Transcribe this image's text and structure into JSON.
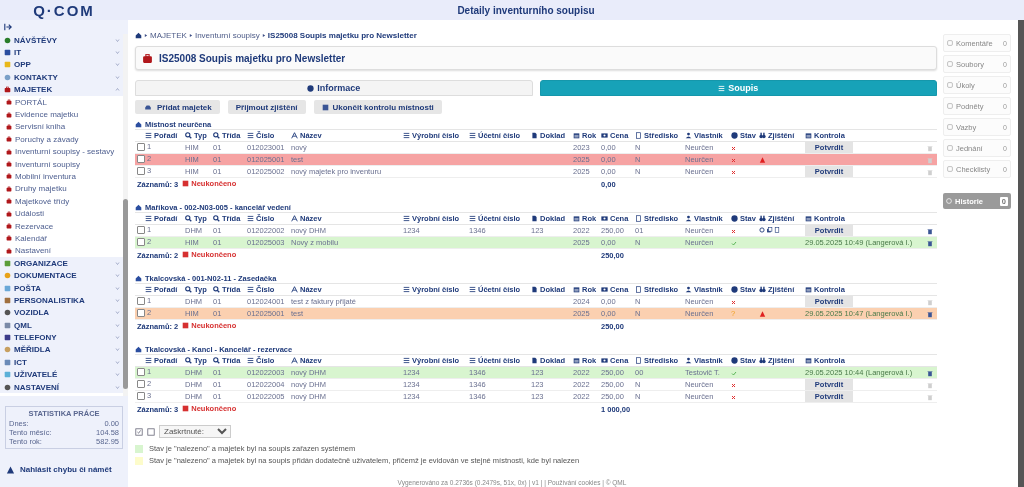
{
  "header": {
    "logo": "Q·COM",
    "title": "Detaily inventurního soupisu"
  },
  "sidebar": {
    "items": [
      {
        "label": "NÁVŠTĚVY",
        "expanded": false
      },
      {
        "label": "IT",
        "expanded": false
      },
      {
        "label": "OPP",
        "expanded": false
      },
      {
        "label": "KONTAKTY",
        "expanded": false
      },
      {
        "label": "MAJETEK",
        "expanded": true,
        "children": [
          {
            "label": "PORTÁL"
          },
          {
            "label": "Evidence majetku"
          },
          {
            "label": "Servisní kniha"
          },
          {
            "label": "Poruchy a závady"
          },
          {
            "label": "Inventurní soupisy - sestavy"
          },
          {
            "label": "Inventurní soupisy"
          },
          {
            "label": "Mobilní inventura"
          },
          {
            "label": "Druhy majetku"
          },
          {
            "label": "Majetkové třídy"
          },
          {
            "label": "Události"
          },
          {
            "label": "Rezervace"
          },
          {
            "label": "Kalendář"
          },
          {
            "label": "Nastavení"
          }
        ]
      },
      {
        "label": "ORGANIZACE",
        "expanded": false
      },
      {
        "label": "DOKUMENTACE",
        "expanded": false
      },
      {
        "label": "POŠTA",
        "expanded": false
      },
      {
        "label": "PERSONALISTIKA",
        "expanded": false
      },
      {
        "label": "VOZIDLA",
        "expanded": false
      },
      {
        "label": "QML",
        "expanded": false
      },
      {
        "label": "TELEFONY",
        "expanded": false
      },
      {
        "label": "MĚŘIDLA",
        "expanded": false
      },
      {
        "label": "ICT",
        "expanded": false
      },
      {
        "label": "UŽIVATELÉ",
        "expanded": false
      },
      {
        "label": "NASTAVENÍ",
        "expanded": false
      }
    ],
    "stats": {
      "title": "STATISTIKA PRÁCE",
      "rows": [
        {
          "label": "Dnes:",
          "value": "0.00"
        },
        {
          "label": "Tento měsíc:",
          "value": "104.58"
        },
        {
          "label": "Tento rok:",
          "value": "582.95"
        }
      ]
    },
    "report_link": "Nahlásit chybu či námět"
  },
  "breadcrumb": [
    "MAJETEK",
    "Inventurní soupisy",
    "IS25008 Soupis majetku pro Newsletter"
  ],
  "page_title": "IS25008 Soupis majetku pro Newsletter",
  "tabs": [
    {
      "label": "Informace",
      "selected": false
    },
    {
      "label": "Soupis",
      "selected": true
    }
  ],
  "actions": [
    "Přidat majetek",
    "Přijmout zjištění",
    "Ukončit kontrolu místnosti"
  ],
  "sections": [
    {
      "title": "Místnost neurčena",
      "columns": [
        "Pořadí",
        "Typ",
        "Třída",
        "Číslo",
        "Název",
        "Výrobní číslo",
        "Účetní číslo",
        "Doklad",
        "Rok",
        "Cena",
        "Středisko",
        "Vlastník",
        "Stav",
        "Zjištění",
        "Kontrola"
      ],
      "rows": [
        {
          "checked": false,
          "poradi": "1",
          "typ": "HIM",
          "trida": "01",
          "cislo": "012023001",
          "nazev": "nový",
          "rok": "2023",
          "cena": "0,00",
          "stredisko": "N",
          "vlastnik": "Neurčen",
          "stav": {
            "kind": "missing"
          },
          "kontrola": {
            "kind": "button",
            "label": "Potvrdit"
          },
          "delete_enabled": false
        },
        {
          "checked": false,
          "color": "#f6a3a3",
          "poradi": "2",
          "typ": "HIM",
          "trida": "01",
          "cislo": "012025001",
          "nazev": "test",
          "rok": "2025",
          "cena": "0,00",
          "stredisko": "N",
          "vlastnik": "Neurčen",
          "stav": {
            "kind": "missing"
          },
          "zjisteni": {
            "kind": "warning"
          },
          "delete_enabled": false
        },
        {
          "checked": false,
          "poradi": "3",
          "typ": "HIM",
          "trida": "01",
          "cislo": "012025002",
          "nazev": "nový majetek pro inventuru",
          "rok": "2025",
          "cena": "0,00",
          "stredisko": "N",
          "vlastnik": "Neurčen",
          "stav": {
            "kind": "missing"
          },
          "kontrola": {
            "kind": "button",
            "label": "Potvrdit"
          },
          "delete_enabled": false
        }
      ],
      "count": "Záznamů: 3",
      "status": "Neukončeno",
      "total": "0,00"
    },
    {
      "title": "Maříkova - 002-N03-005 - kancelář vedení",
      "columns": [
        "Pořadí",
        "Typ",
        "Třída",
        "Číslo",
        "Název",
        "Výrobní číslo",
        "Účetní číslo",
        "Doklad",
        "Rok",
        "Cena",
        "Středisko",
        "Vlastník",
        "Stav",
        "Zjištění",
        "Kontrola"
      ],
      "rows": [
        {
          "checked": false,
          "poradi": "1",
          "typ": "DHM",
          "trida": "01",
          "cislo": "012022002",
          "nazev": "nový DHM",
          "vyrobni": "1234",
          "ucetni": "1346",
          "doklad": "123",
          "rok": "2022",
          "cena": "250,00",
          "stredisko": "01",
          "vlastnik": "Neurčen",
          "stav": {
            "kind": "missing"
          },
          "zjisteni": {
            "kind": "tools"
          },
          "kontrola": {
            "kind": "button",
            "label": "Potvrdit"
          },
          "delete_enabled": true
        },
        {
          "checked": false,
          "color": "#d8f5cf",
          "poradi": "2",
          "typ": "HIM",
          "trida": "01",
          "cislo": "012025003",
          "nazev": "Novy z mobilu",
          "rok": "2025",
          "cena": "0,00",
          "stredisko": "N",
          "vlastnik": "Neurčen",
          "stav": {
            "kind": "found"
          },
          "kontrola": {
            "kind": "text",
            "label": "29.05.2025 10:49 (Langerová I.)"
          },
          "delete_enabled": true
        }
      ],
      "count": "Záznamů: 2",
      "status": "Neukončeno",
      "total": "250,00"
    },
    {
      "title": "Tkalcovská - 001-N02-11 - Zasedačka",
      "columns": [
        "Pořadí",
        "Typ",
        "Třída",
        "Číslo",
        "Název",
        "Výrobní číslo",
        "Účetní číslo",
        "Doklad",
        "Rok",
        "Cena",
        "Středisko",
        "Vlastník",
        "Stav",
        "Zjištění",
        "Kontrola"
      ],
      "rows": [
        {
          "checked": false,
          "poradi": "1",
          "typ": "DHM",
          "trida": "01",
          "cislo": "012024001",
          "nazev": "test z faktury přijaté",
          "rok": "2024",
          "cena": "0,00",
          "stredisko": "N",
          "vlastnik": "Neurčen",
          "stav": {
            "kind": "missing"
          },
          "kontrola": {
            "kind": "button",
            "label": "Potvrdit"
          },
          "delete_enabled": false
        },
        {
          "checked": false,
          "color": "#fbd0b0",
          "poradi": "2",
          "typ": "HIM",
          "trida": "01",
          "cislo": "012025001",
          "nazev": "test",
          "rok": "2025",
          "cena": "0,00",
          "stredisko": "N",
          "vlastnik": "Neurčen",
          "stav": {
            "kind": "unknown",
            "symbol": "?"
          },
          "zjisteni": {
            "kind": "warning"
          },
          "kontrola": {
            "kind": "text",
            "label": "29.05.2025 10:47 (Langerová I.)"
          },
          "delete_enabled": true
        }
      ],
      "count": "Záznamů: 2",
      "status": "Neukončeno",
      "total": "250,00"
    },
    {
      "title": "Tkalcovská - Kancl - Kancelář - rezervace",
      "columns": [
        "Pořadí",
        "Typ",
        "Třída",
        "Číslo",
        "Název",
        "Výrobní číslo",
        "Účetní číslo",
        "Doklad",
        "Rok",
        "Cena",
        "Středisko",
        "Vlastník",
        "Stav",
        "Zjištění",
        "Kontrola"
      ],
      "rows": [
        {
          "checked": false,
          "color": "#d8f5cf",
          "poradi": "1",
          "typ": "DHM",
          "trida": "01",
          "cislo": "012022003",
          "nazev": "nový DHM",
          "vyrobni": "1234",
          "ucetni": "1346",
          "doklad": "123",
          "rok": "2022",
          "cena": "250,00",
          "stredisko": "00",
          "vlastnik": "Testovič T.",
          "stav": {
            "kind": "found"
          },
          "kontrola": {
            "kind": "text",
            "label": "29.05.2025 10:44 (Langerová I.)"
          },
          "delete_enabled": true
        },
        {
          "checked": false,
          "poradi": "2",
          "typ": "DHM",
          "trida": "01",
          "cislo": "012022004",
          "nazev": "nový DHM",
          "vyrobni": "1234",
          "ucetni": "1346",
          "doklad": "123",
          "rok": "2022",
          "cena": "250,00",
          "stredisko": "N",
          "vlastnik": "Neurčen",
          "stav": {
            "kind": "missing"
          },
          "kontrola": {
            "kind": "button",
            "label": "Potvrdit"
          },
          "delete_enabled": false
        },
        {
          "checked": false,
          "poradi": "3",
          "typ": "DHM",
          "trida": "01",
          "cislo": "012022005",
          "nazev": "nový DHM",
          "vyrobni": "1234",
          "ucetni": "1346",
          "doklad": "123",
          "rok": "2022",
          "cena": "250,00",
          "stredisko": "N",
          "vlastnik": "Neurčen",
          "stav": {
            "kind": "missing"
          },
          "kontrola": {
            "kind": "button",
            "label": "Potvrdit"
          },
          "delete_enabled": false
        }
      ],
      "count": "Záznamů: 3",
      "status": "Neukončeno",
      "total": "1 000,00"
    }
  ],
  "bulk": {
    "select": "Zaškrtnuté:"
  },
  "legend": [
    {
      "color": "#d8f5cf",
      "text": "Stav je \"nalezeno\" a majetek byl na soupis zařazen systémem"
    },
    {
      "color": "#fdfccb",
      "text": "Stav je \"nalezeno\" a majetek byl na soupis přidán dodatečně uživatelem, přičemž je evidován ve stejné místnosti, kde byl nalezen"
    }
  ],
  "footer": "Vygenerováno za 0.2736s (0.2479s, 51x, 0x) | v1 | | Používání cookies | © QML",
  "side_panel": {
    "items": [
      {
        "label": "Komentáře",
        "count": "0"
      },
      {
        "label": "Soubory",
        "count": "0"
      },
      {
        "label": "Úkoly",
        "count": "0"
      },
      {
        "label": "Podněty",
        "count": "0"
      },
      {
        "label": "Vazby",
        "count": "0"
      },
      {
        "label": "Jednání",
        "count": "0"
      },
      {
        "label": "Checklisty",
        "count": "0"
      }
    ],
    "history": {
      "label": "Historie",
      "count": "0"
    }
  }
}
